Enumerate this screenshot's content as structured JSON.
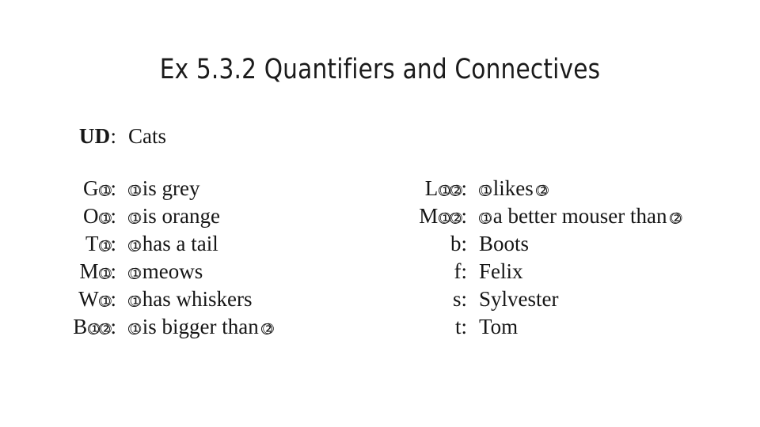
{
  "slide": {
    "title": "Ex 5.3.2 Quantifiers and Connectives",
    "background_color": "#ffffff",
    "text_color": "#161616"
  },
  "left_column": {
    "ud": {
      "label": "UD",
      "separator": ":",
      "value": "Cats"
    },
    "predicates": [
      {
        "symbol": "G",
        "places": [
          "1"
        ],
        "label": "G①:",
        "gloss": "① is grey",
        "gloss_text": "is grey",
        "gloss_args": [
          "1"
        ]
      },
      {
        "symbol": "O",
        "places": [
          "1"
        ],
        "label": "O①:",
        "gloss": "① is orange",
        "gloss_text": "is orange",
        "gloss_args": [
          "1"
        ]
      },
      {
        "symbol": "T",
        "places": [
          "1"
        ],
        "label": "T①:",
        "gloss": "① has a tail",
        "gloss_text": "has a tail",
        "gloss_args": [
          "1"
        ]
      },
      {
        "symbol": "M",
        "places": [
          "1"
        ],
        "label": "M①:",
        "gloss": "① meows",
        "gloss_text": "meows",
        "gloss_args": [
          "1"
        ]
      },
      {
        "symbol": "W",
        "places": [
          "1"
        ],
        "label": "W①:",
        "gloss": "① has whiskers",
        "gloss_text": "has whiskers",
        "gloss_args": [
          "1"
        ]
      },
      {
        "symbol": "B",
        "places": [
          "1",
          "2"
        ],
        "label": "B①②:",
        "gloss": "① is bigger than ②",
        "gloss_text": "is bigger than",
        "gloss_args": [
          "1",
          "2"
        ]
      }
    ]
  },
  "right_column": {
    "predicates": [
      {
        "symbol": "L",
        "places": [
          "1",
          "2"
        ],
        "label": "L①②:",
        "gloss": "① likes ②",
        "gloss_text": "likes",
        "gloss_args": [
          "1",
          "2"
        ]
      },
      {
        "symbol": "M",
        "places": [
          "1",
          "2"
        ],
        "label": "M①②:",
        "gloss": "① a better mouser than ②",
        "gloss_text": "a better mouser than",
        "gloss_args": [
          "1",
          "2"
        ]
      }
    ],
    "constants": [
      {
        "symbol": "b",
        "label": "b:",
        "name": "Boots"
      },
      {
        "symbol": "f",
        "label": "f:",
        "name": "Felix"
      },
      {
        "symbol": "s",
        "label": "s:",
        "name": "Sylvester"
      },
      {
        "symbol": "t",
        "label": "t:",
        "name": "Tom"
      }
    ]
  },
  "glyphs": {
    "circled_one": "①",
    "circled_two": "②",
    "colon": ":"
  }
}
